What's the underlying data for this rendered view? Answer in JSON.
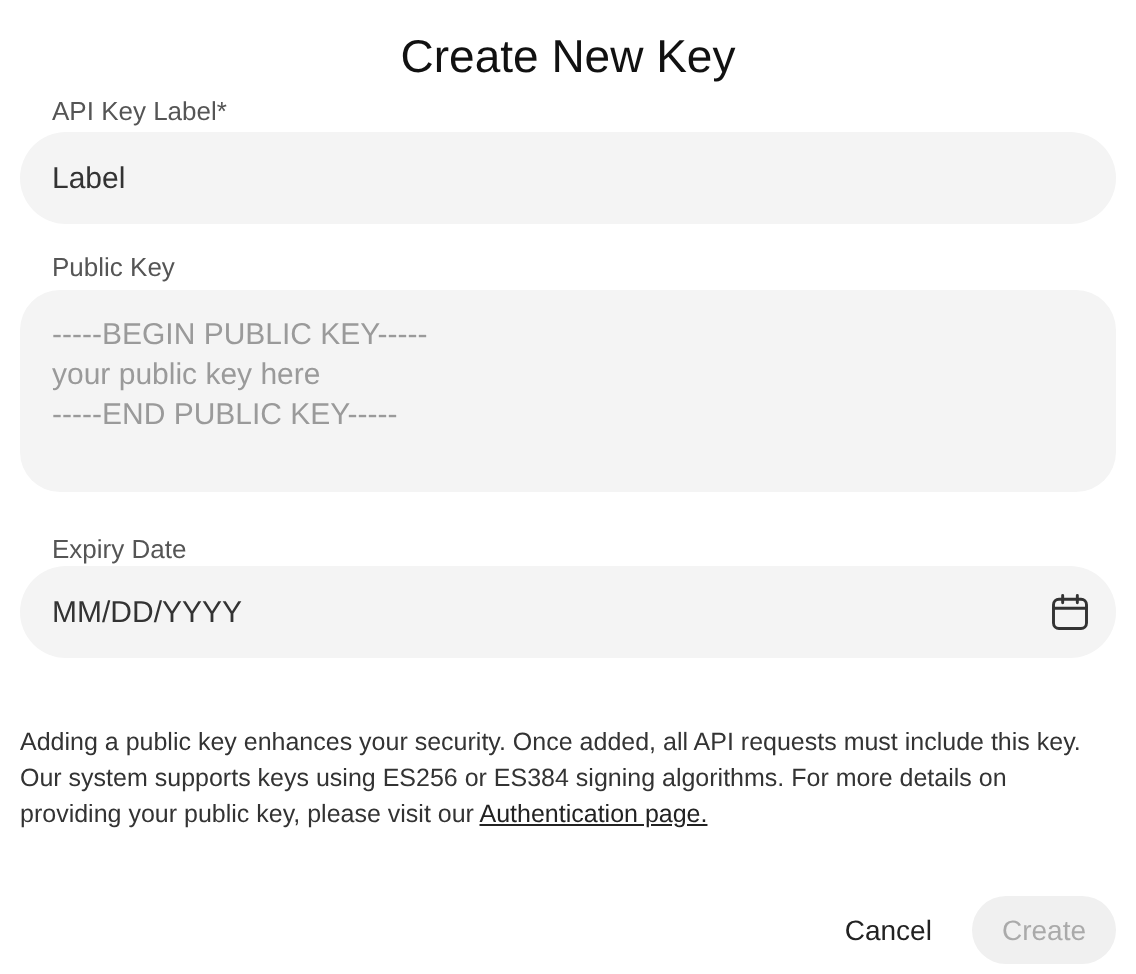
{
  "dialog": {
    "title": "Create New Key"
  },
  "fields": [
    {
      "kind": "text",
      "label": "API Key Label*",
      "placeholder": "Label"
    },
    {
      "kind": "textarea",
      "label": "Public Key",
      "placeholder": "-----BEGIN PUBLIC KEY-----\nyour public key here\n-----END PUBLIC KEY-----"
    },
    {
      "kind": "date",
      "label": "Expiry Date",
      "placeholder": "MM/DD/YYYY"
    }
  ],
  "note": {
    "text": "Adding a public key enhances your security. Once added, all API requests must include this key. Our system supports keys using ES256 or ES384 signing algorithms. For more details on providing your public key, please visit our",
    "link": "Authentication page."
  },
  "buttons": [
    {
      "label": "Cancel",
      "kind": "secondary",
      "disabled": false
    },
    {
      "label": "Create",
      "kind": "primary",
      "disabled": true
    }
  ]
}
